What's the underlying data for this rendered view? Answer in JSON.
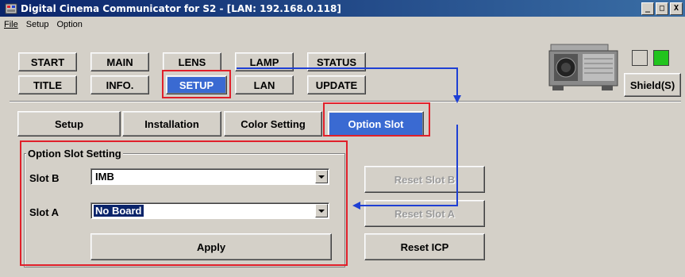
{
  "window": {
    "title": "Digital Cinema Communicator for S2 - [LAN: 192.168.0.118]",
    "controls": [
      "_",
      "□",
      "X"
    ]
  },
  "menu": [
    "File",
    "Setup",
    "Option"
  ],
  "nav": {
    "row1": [
      "START",
      "MAIN",
      "LENS",
      "LAMP",
      "STATUS"
    ],
    "row2": [
      "TITLE",
      "INFO.",
      "SETUP",
      "LAN",
      "UPDATE"
    ],
    "active": "SETUP"
  },
  "shield_button": "Shield(S)",
  "status_colors": {
    "indicator1": "#d4d0c8",
    "indicator2": "#22c41e"
  },
  "tabs": [
    "Setup",
    "Installation",
    "Color Setting",
    "Option Slot"
  ],
  "active_tab": "Option Slot",
  "option_slot": {
    "group_title": "Option Slot Setting",
    "slot_b": {
      "label": "Slot B",
      "value": "IMB"
    },
    "slot_a": {
      "label": "Slot A",
      "value": "No Board"
    },
    "apply": "Apply"
  },
  "actions": {
    "reset_slot_b": "Reset Slot B",
    "reset_slot_a": "Reset Slot A",
    "reset_icp": "Reset ICP"
  },
  "colors": {
    "active_tab": "#3a6ad2",
    "highlight_box": "#e0202a",
    "arrow": "#1e3fd4"
  }
}
